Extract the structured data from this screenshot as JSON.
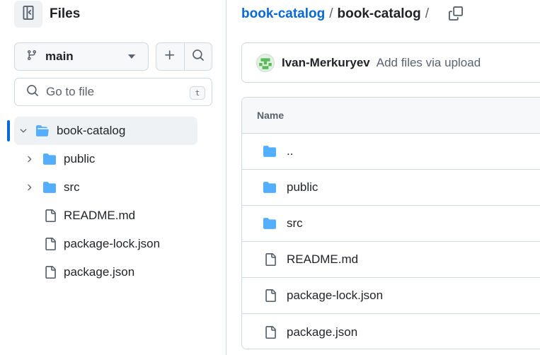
{
  "header": {
    "title": "Files"
  },
  "branch": {
    "name": "main"
  },
  "search": {
    "placeholder": "Go to file",
    "shortcut": "t"
  },
  "tree": {
    "root": {
      "name": "book-catalog",
      "type": "folder",
      "expanded": true
    },
    "items": [
      {
        "name": "public",
        "type": "folder"
      },
      {
        "name": "src",
        "type": "folder"
      },
      {
        "name": "README.md",
        "type": "file"
      },
      {
        "name": "package-lock.json",
        "type": "file"
      },
      {
        "name": "package.json",
        "type": "file"
      }
    ]
  },
  "breadcrumb": {
    "repo": "book-catalog",
    "separator": "/",
    "current": "book-catalog",
    "trailing": "/"
  },
  "commit": {
    "author": "Ivan-Merkuryev",
    "message": "Add files via upload"
  },
  "table": {
    "header": "Name",
    "rows": [
      {
        "name": "..",
        "type": "folder"
      },
      {
        "name": "public",
        "type": "folder"
      },
      {
        "name": "src",
        "type": "folder"
      },
      {
        "name": "README.md",
        "type": "file"
      },
      {
        "name": "package-lock.json",
        "type": "file"
      },
      {
        "name": "package.json",
        "type": "file"
      }
    ]
  },
  "icons": {
    "panel": "sidebar-collapse-icon",
    "branch": "git-branch-icon",
    "add": "plus-icon",
    "search": "search-icon",
    "copy": "copy-icon",
    "folder": "folder-icon",
    "file": "file-icon",
    "chevron": "chevron-right-icon"
  },
  "colors": {
    "link": "#0969da",
    "folder": "#54aeff",
    "active_bar": "#0969da",
    "muted": "#59636e"
  }
}
